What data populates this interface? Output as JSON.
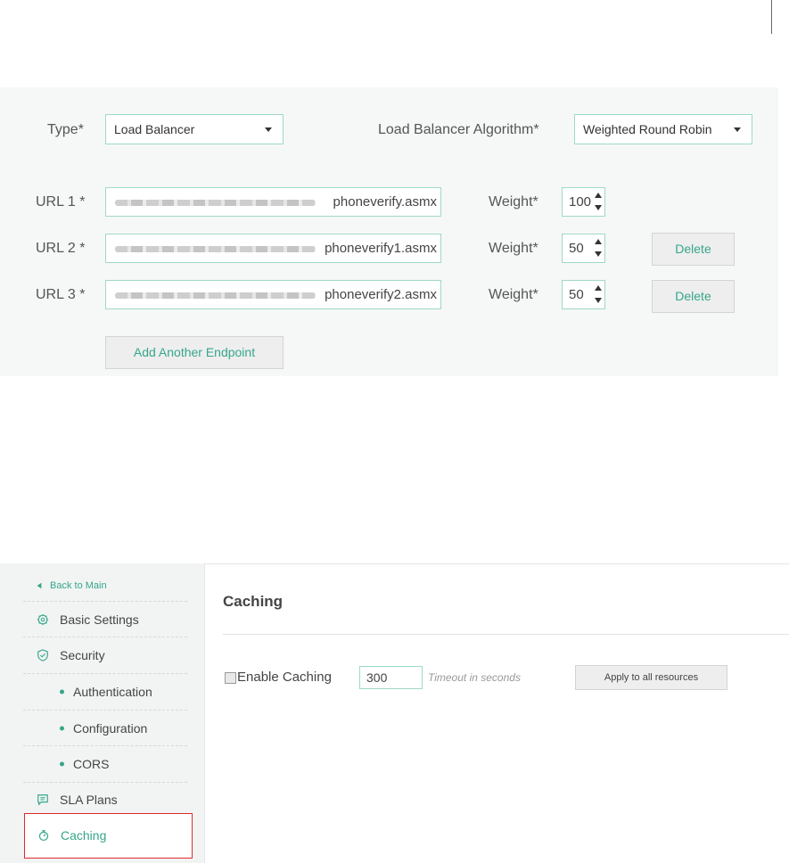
{
  "endpoint_config": {
    "type_label": "Type*",
    "type_value": "Load Balancer",
    "algorithm_label": "Load Balancer Algorithm*",
    "algorithm_value": "Weighted Round Robin",
    "endpoints": [
      {
        "label": "URL 1 *",
        "url_visible": "phoneverify.asmx",
        "weight_label": "Weight*",
        "weight": "100",
        "delete_label": ""
      },
      {
        "label": "URL 2 *",
        "url_visible": "phoneverify1.asmx",
        "weight_label": "Weight*",
        "weight": "50",
        "delete_label": "Delete"
      },
      {
        "label": "URL 3 *",
        "url_visible": "phoneverify2.asmx",
        "weight_label": "Weight*",
        "weight": "50",
        "delete_label": "Delete"
      }
    ],
    "add_endpoint_label": "Add Another Endpoint",
    "accent_color": "#36a68a",
    "field_border_color": "#9ed9c9"
  },
  "sidebar": {
    "back_label": "Back to Main",
    "items": [
      {
        "label": "Basic Settings",
        "icon": "gear-icon"
      },
      {
        "label": "Security",
        "icon": "shield-icon"
      },
      {
        "label": "Authentication",
        "icon": "bullet"
      },
      {
        "label": "Configuration",
        "icon": "bullet"
      },
      {
        "label": "CORS",
        "icon": "bullet"
      },
      {
        "label": "SLA Plans",
        "icon": "message-icon"
      },
      {
        "label": "Caching",
        "icon": "stopwatch-icon",
        "selected": true
      }
    ],
    "highlight_color": "#e0282c"
  },
  "caching": {
    "title": "Caching",
    "enable_label": "Enable Caching",
    "enabled": false,
    "timeout_value": "300",
    "timeout_hint": "Timeout in seconds",
    "apply_label": "Apply to all resources"
  }
}
